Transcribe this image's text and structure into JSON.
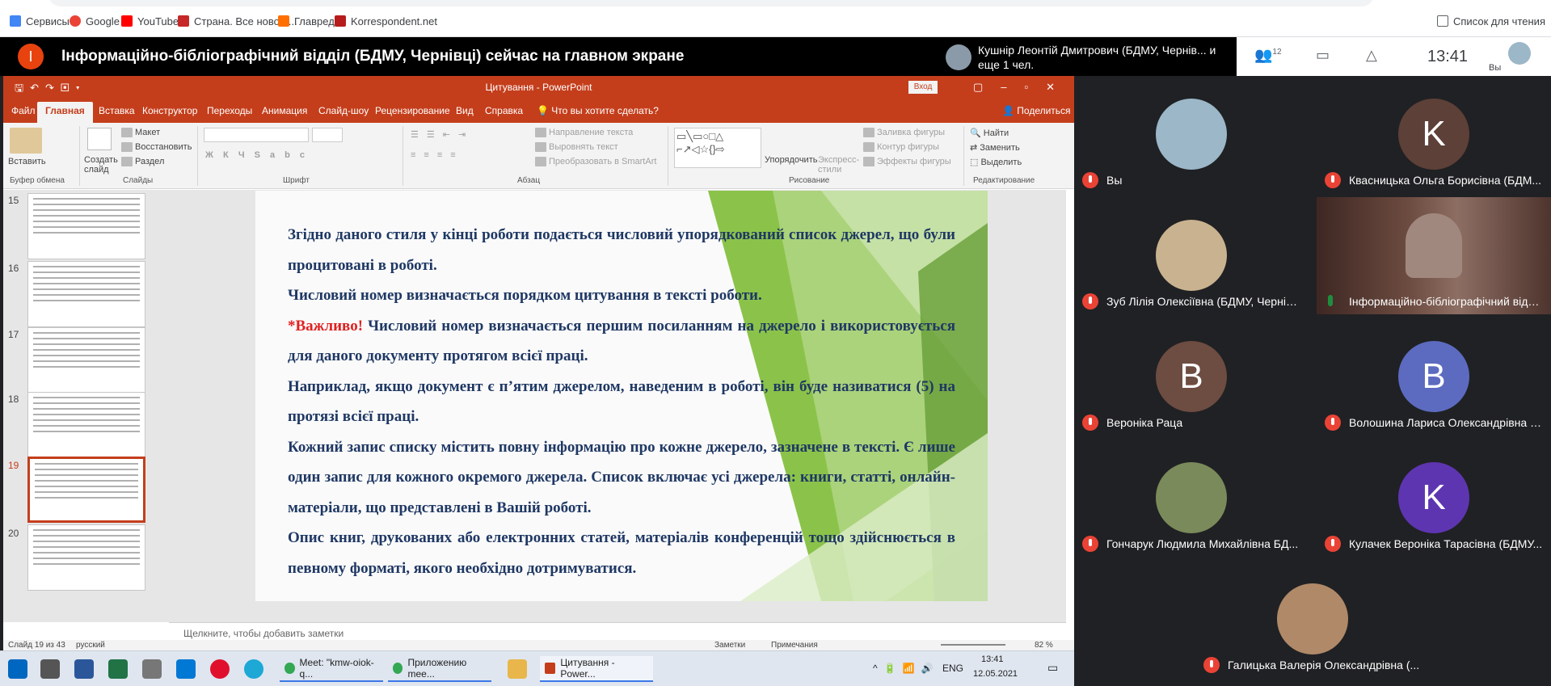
{
  "bookmarks": [
    {
      "label": "Сервисы",
      "icon": "apps-grid-icon",
      "color": "#4285f4"
    },
    {
      "label": "Google",
      "icon": "google-icon",
      "color": "#ea4335"
    },
    {
      "label": "YouTube",
      "icon": "youtube-icon",
      "color": "#ff0000"
    },
    {
      "label": "Страна. Все новост...",
      "icon": "strana-icon",
      "color": "#c62828"
    },
    {
      "label": "Главред",
      "icon": "glavred-icon",
      "color": "#ff6f00"
    },
    {
      "label": "Korrespondent.net",
      "icon": "korrespondent-icon",
      "color": "#b71c1c"
    }
  ],
  "reading_list": "Список для чтения",
  "banner": {
    "badge": "І",
    "title": "Інформаційно-бібліографічний відділ (БДМУ, Чернівці) сейчас на главном экране",
    "presenter": "Кушнір Леонтій Дмитрович (БДМУ, Чернів... и еще 1 чел.",
    "participants_count": "12",
    "time": "13:41",
    "you_label": "Вы"
  },
  "ppt": {
    "title": "Цитування - PowerPoint",
    "signin": "Вход",
    "tabs": [
      "Файл",
      "Главная",
      "Вставка",
      "Конструктор",
      "Переходы",
      "Анимация",
      "Слайд-шоу",
      "Рецензирование",
      "Вид",
      "Справка"
    ],
    "tell_me": "Что вы хотите сделать?",
    "share": "Поделиться",
    "ribbon": {
      "paste": "Вставить",
      "clipboard": "Буфер обмена",
      "new_slide": "Создать слайд",
      "layout": "Макет",
      "reset": "Восстановить",
      "section": "Раздел",
      "slides": "Слайды",
      "font": "Шрифт",
      "paragraph": "Абзац",
      "text_direction": "Направление текста",
      "align_text": "Выровнять текст",
      "smartart": "Преобразовать в SmartArt",
      "arrange": "Упорядочить",
      "quick_styles": "Экспресс-стили",
      "shape_fill": "Заливка фигуры",
      "shape_outline": "Контур фигуры",
      "shape_effects": "Эффекты фигуры",
      "drawing": "Рисование",
      "find": "Найти",
      "replace": "Заменить",
      "select": "Выделить",
      "editing": "Редактирование"
    },
    "thumbs": [
      {
        "num": "15",
        "selected": false
      },
      {
        "num": "16",
        "selected": false
      },
      {
        "num": "17",
        "selected": false
      },
      {
        "num": "18",
        "selected": false
      },
      {
        "num": "19",
        "selected": true
      },
      {
        "num": "20",
        "selected": false
      }
    ],
    "slide": {
      "p1": "Згідно даного стиля у кінці роботи подається числовий упорядкований список джерел, що були процитовані в роботі.",
      "p2": "Числовий номер визначається порядком цитування в тексті роботи.",
      "p3_important": "*Важливо!",
      "p3_rest": " Числовий номер визначається першим посиланням на джерело і використовується для даного документу протягом всієї праці.",
      "p4": "Наприклад, якщо документ є п’ятим джерелом, наведеним в роботі, він буде називатися (5) на протязі всієї праці.",
      "p5": "Кожний запис списку містить повну інформацію про кожне джерело, зазначене в тексті. Є лише один запис для кожного окремого джерела. Список включає усі джерела: книги, статті, онлайн-матеріали, що представлені в Вашій роботі.",
      "p6": "Опис книг, друкованих або електронних статей, матеріалів конференцій тощо здійснюється в певному форматі, якого необхідно дотримуватися."
    },
    "notes_placeholder": "Щелкните, чтобы добавить заметки",
    "status": {
      "slide_of": "Слайд 19 из 43",
      "language": "русский",
      "notes": "Заметки",
      "comments": "Примечания",
      "zoom": "82 %"
    }
  },
  "taskbar": {
    "items": [
      "Meet: \"kmw-oiok-q...",
      "Приложению mee...",
      "Цитування - Power..."
    ],
    "lang": "ENG",
    "time": "13:41",
    "date": "12.05.2021"
  },
  "participants": [
    {
      "name": "Вы",
      "initial": "",
      "avatar_color": "#9bb7c8",
      "photo": true
    },
    {
      "name": "Квасницька Ольга Борисівна (БДМ...",
      "initial": "K",
      "avatar_color": "#5d4037",
      "photo": false
    },
    {
      "name": "Зуб Лілія Олексіївна (БДМУ, Чернів...",
      "initial": "",
      "avatar_color": "#c9b28f",
      "photo": true
    },
    {
      "name": "Інформаційно-бібліографічний відд...",
      "initial": "",
      "avatar_color": "#6d4c41",
      "photo": true
    },
    {
      "name": "Вероніка Раца",
      "initial": "B",
      "avatar_color": "#6d4c41",
      "photo": false
    },
    {
      "name": "Волошина Лариса Олександрівна (...",
      "initial": "B",
      "avatar_color": "#5c6bc0",
      "photo": false
    },
    {
      "name": "Гончарук Людмила Михайлівна БД...",
      "initial": "",
      "avatar_color": "#7a8a5a",
      "photo": true
    },
    {
      "name": "Кулачек Вероніка Тарасівна (БДМУ...",
      "initial": "K",
      "avatar_color": "#5e35b1",
      "photo": false
    },
    {
      "name": "Галицька Валерія Олександрівна (...",
      "initial": "",
      "avatar_color": "#b08968",
      "photo": true
    }
  ]
}
